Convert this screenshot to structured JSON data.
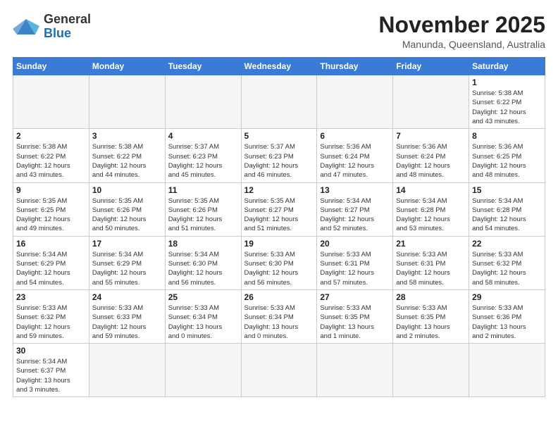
{
  "header": {
    "logo_general": "General",
    "logo_blue": "Blue",
    "month_title": "November 2025",
    "location": "Manunda, Queensland, Australia"
  },
  "weekdays": [
    "Sunday",
    "Monday",
    "Tuesday",
    "Wednesday",
    "Thursday",
    "Friday",
    "Saturday"
  ],
  "weeks": [
    [
      {
        "day": "",
        "info": ""
      },
      {
        "day": "",
        "info": ""
      },
      {
        "day": "",
        "info": ""
      },
      {
        "day": "",
        "info": ""
      },
      {
        "day": "",
        "info": ""
      },
      {
        "day": "",
        "info": ""
      },
      {
        "day": "1",
        "info": "Sunrise: 5:38 AM\nSunset: 6:22 PM\nDaylight: 12 hours\nand 43 minutes."
      }
    ],
    [
      {
        "day": "2",
        "info": "Sunrise: 5:38 AM\nSunset: 6:22 PM\nDaylight: 12 hours\nand 43 minutes."
      },
      {
        "day": "3",
        "info": "Sunrise: 5:38 AM\nSunset: 6:22 PM\nDaylight: 12 hours\nand 44 minutes."
      },
      {
        "day": "4",
        "info": "Sunrise: 5:37 AM\nSunset: 6:23 PM\nDaylight: 12 hours\nand 45 minutes."
      },
      {
        "day": "5",
        "info": "Sunrise: 5:37 AM\nSunset: 6:23 PM\nDaylight: 12 hours\nand 46 minutes."
      },
      {
        "day": "6",
        "info": "Sunrise: 5:36 AM\nSunset: 6:24 PM\nDaylight: 12 hours\nand 47 minutes."
      },
      {
        "day": "7",
        "info": "Sunrise: 5:36 AM\nSunset: 6:24 PM\nDaylight: 12 hours\nand 48 minutes."
      },
      {
        "day": "8",
        "info": "Sunrise: 5:36 AM\nSunset: 6:25 PM\nDaylight: 12 hours\nand 48 minutes."
      }
    ],
    [
      {
        "day": "9",
        "info": "Sunrise: 5:35 AM\nSunset: 6:25 PM\nDaylight: 12 hours\nand 49 minutes."
      },
      {
        "day": "10",
        "info": "Sunrise: 5:35 AM\nSunset: 6:26 PM\nDaylight: 12 hours\nand 50 minutes."
      },
      {
        "day": "11",
        "info": "Sunrise: 5:35 AM\nSunset: 6:26 PM\nDaylight: 12 hours\nand 51 minutes."
      },
      {
        "day": "12",
        "info": "Sunrise: 5:35 AM\nSunset: 6:27 PM\nDaylight: 12 hours\nand 51 minutes."
      },
      {
        "day": "13",
        "info": "Sunrise: 5:34 AM\nSunset: 6:27 PM\nDaylight: 12 hours\nand 52 minutes."
      },
      {
        "day": "14",
        "info": "Sunrise: 5:34 AM\nSunset: 6:28 PM\nDaylight: 12 hours\nand 53 minutes."
      },
      {
        "day": "15",
        "info": "Sunrise: 5:34 AM\nSunset: 6:28 PM\nDaylight: 12 hours\nand 54 minutes."
      }
    ],
    [
      {
        "day": "16",
        "info": "Sunrise: 5:34 AM\nSunset: 6:29 PM\nDaylight: 12 hours\nand 54 minutes."
      },
      {
        "day": "17",
        "info": "Sunrise: 5:34 AM\nSunset: 6:29 PM\nDaylight: 12 hours\nand 55 minutes."
      },
      {
        "day": "18",
        "info": "Sunrise: 5:34 AM\nSunset: 6:30 PM\nDaylight: 12 hours\nand 56 minutes."
      },
      {
        "day": "19",
        "info": "Sunrise: 5:33 AM\nSunset: 6:30 PM\nDaylight: 12 hours\nand 56 minutes."
      },
      {
        "day": "20",
        "info": "Sunrise: 5:33 AM\nSunset: 6:31 PM\nDaylight: 12 hours\nand 57 minutes."
      },
      {
        "day": "21",
        "info": "Sunrise: 5:33 AM\nSunset: 6:31 PM\nDaylight: 12 hours\nand 58 minutes."
      },
      {
        "day": "22",
        "info": "Sunrise: 5:33 AM\nSunset: 6:32 PM\nDaylight: 12 hours\nand 58 minutes."
      }
    ],
    [
      {
        "day": "23",
        "info": "Sunrise: 5:33 AM\nSunset: 6:32 PM\nDaylight: 12 hours\nand 59 minutes."
      },
      {
        "day": "24",
        "info": "Sunrise: 5:33 AM\nSunset: 6:33 PM\nDaylight: 12 hours\nand 59 minutes."
      },
      {
        "day": "25",
        "info": "Sunrise: 5:33 AM\nSunset: 6:34 PM\nDaylight: 13 hours\nand 0 minutes."
      },
      {
        "day": "26",
        "info": "Sunrise: 5:33 AM\nSunset: 6:34 PM\nDaylight: 13 hours\nand 0 minutes."
      },
      {
        "day": "27",
        "info": "Sunrise: 5:33 AM\nSunset: 6:35 PM\nDaylight: 13 hours\nand 1 minute."
      },
      {
        "day": "28",
        "info": "Sunrise: 5:33 AM\nSunset: 6:35 PM\nDaylight: 13 hours\nand 2 minutes."
      },
      {
        "day": "29",
        "info": "Sunrise: 5:33 AM\nSunset: 6:36 PM\nDaylight: 13 hours\nand 2 minutes."
      }
    ],
    [
      {
        "day": "30",
        "info": "Sunrise: 5:34 AM\nSunset: 6:37 PM\nDaylight: 13 hours\nand 3 minutes."
      },
      {
        "day": "",
        "info": ""
      },
      {
        "day": "",
        "info": ""
      },
      {
        "day": "",
        "info": ""
      },
      {
        "day": "",
        "info": ""
      },
      {
        "day": "",
        "info": ""
      },
      {
        "day": "",
        "info": ""
      }
    ]
  ]
}
